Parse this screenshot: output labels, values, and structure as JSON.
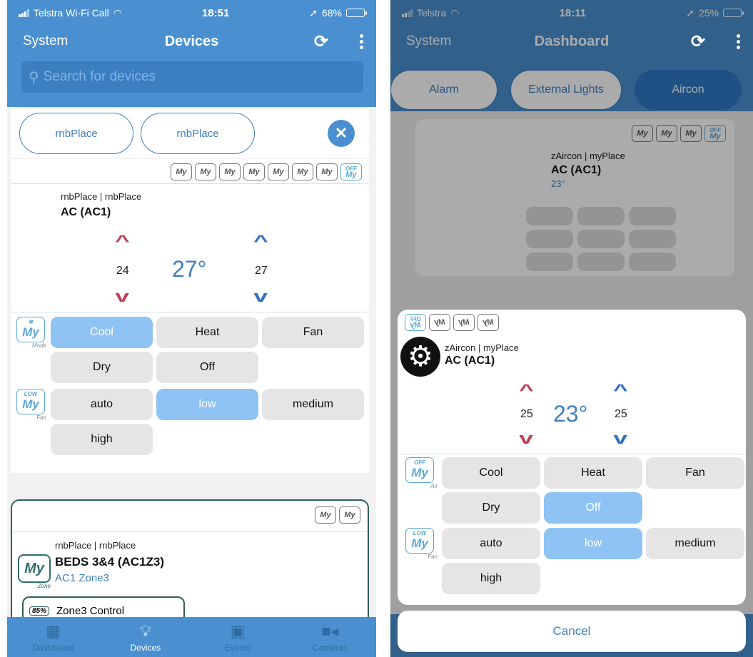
{
  "left": {
    "status": {
      "carrier": "Telstra Wi-Fi Call",
      "time": "18:51",
      "battery": "68%",
      "battery_level": 0.68
    },
    "nav": {
      "back": "System",
      "title": "Devices"
    },
    "search": {
      "placeholder": "Search for devices"
    },
    "filter_chips": [
      "rnbPlace",
      "rnbPlace"
    ],
    "my_icon_text": "My",
    "off_label": "OFF",
    "card1": {
      "sub": "rnbPlace | rnbPlace",
      "name": "AC (AC1)",
      "set_heat": "24",
      "current": "27°",
      "set_cool": "27",
      "mode_badge": {
        "caption": "Mode"
      },
      "fan_badge": {
        "top": "LOW",
        "caption": "Fan"
      },
      "modes": [
        {
          "label": "Cool",
          "selected": true
        },
        {
          "label": "Heat",
          "selected": false
        },
        {
          "label": "Fan",
          "selected": false
        },
        {
          "label": "Dry",
          "selected": false
        },
        {
          "label": "Off",
          "selected": false
        }
      ],
      "fans": [
        {
          "label": "auto",
          "selected": false
        },
        {
          "label": "low",
          "selected": true
        },
        {
          "label": "medium",
          "selected": false
        },
        {
          "label": "high",
          "selected": false
        }
      ]
    },
    "card2": {
      "sub": "rnbPlace | rnbPlace",
      "name": "BEDS 3&4 (AC1Z3)",
      "zone": "AC1 Zone3",
      "zone_caption": "Zone",
      "control_pct": "85%",
      "control_label": "Zone3 Control"
    },
    "tabs": [
      {
        "label": "Dashboard",
        "icon": "dashboard-icon",
        "active": false
      },
      {
        "label": "Devices",
        "icon": "lightbulb-icon",
        "active": true
      },
      {
        "label": "Events",
        "icon": "calendar-icon",
        "active": false
      },
      {
        "label": "Cameras",
        "icon": "camera-icon",
        "active": false
      }
    ]
  },
  "right": {
    "status": {
      "carrier": "Telstra",
      "time": "18:11",
      "battery": "25%",
      "battery_level": 0.25
    },
    "nav": {
      "back": "System",
      "title": "Dashboard"
    },
    "tabs": [
      {
        "label": "Alarm",
        "active": false
      },
      {
        "label": "External Lights",
        "active": false
      },
      {
        "label": "Aircon",
        "active": true
      }
    ],
    "bg_card": {
      "sub": "zAircon | myPlace",
      "name": "AC (AC1)",
      "temp": "23°"
    },
    "sheet": {
      "sub": "zAircon | myPlace",
      "name": "AC (AC1)",
      "set_heat": "25",
      "current": "23°",
      "set_cool": "25",
      "mode_badge": {
        "top": "OFF",
        "caption": "Air"
      },
      "fan_badge": {
        "top": "LOW",
        "caption": "Fan"
      },
      "modes": [
        {
          "label": "Cool",
          "selected": false
        },
        {
          "label": "Heat",
          "selected": false
        },
        {
          "label": "Fan",
          "selected": false
        },
        {
          "label": "Dry",
          "selected": false
        },
        {
          "label": "Off",
          "selected": true
        }
      ],
      "fans": [
        {
          "label": "auto",
          "selected": false
        },
        {
          "label": "low",
          "selected": true
        },
        {
          "label": "medium",
          "selected": false
        },
        {
          "label": "high",
          "selected": false
        }
      ]
    },
    "cancel_label": "Cancel",
    "colors": {
      "header": "#4a90d0",
      "selected": "#8ec3f3",
      "up_arrow": "#c0405a",
      "down_arrow": "#2f6fbf"
    }
  }
}
